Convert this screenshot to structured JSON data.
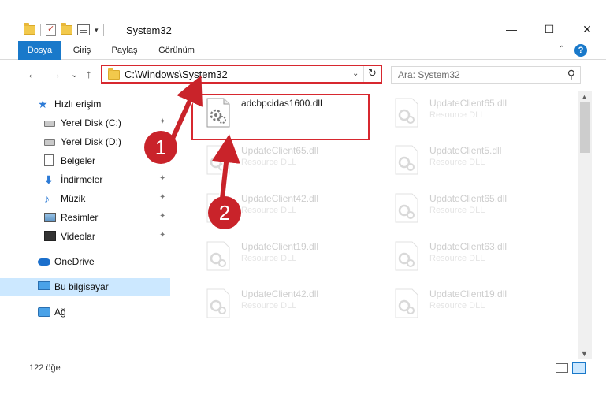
{
  "window": {
    "title": "System32",
    "min_glyph": "—",
    "max_glyph": "☐",
    "close_glyph": "✕"
  },
  "ribbon": {
    "tabs": [
      {
        "label": "Dosya",
        "active": true
      },
      {
        "label": "Giriş",
        "active": false
      },
      {
        "label": "Paylaş",
        "active": false
      },
      {
        "label": "Görünüm",
        "active": false
      }
    ],
    "help": "?",
    "collapse": "⌃"
  },
  "nav": {
    "back": "←",
    "forward": "→",
    "recent": "⌄",
    "up": "↑",
    "address": "C:\\Windows\\System32",
    "address_dropdown": "⌄",
    "refresh": "↻",
    "search_placeholder": "Ara: System32",
    "search_icon": "⚲"
  },
  "sidebar": {
    "items": [
      {
        "label": "Hızlı erişim",
        "icon": "star-icon",
        "pinned": false
      },
      {
        "label": "Yerel Disk (C:)",
        "icon": "drive-icon",
        "pinned": true
      },
      {
        "label": "Yerel Disk (D:)",
        "icon": "drive-icon",
        "pinned": true
      },
      {
        "label": "Belgeler",
        "icon": "document-icon",
        "pinned": true
      },
      {
        "label": "İndirmeler",
        "icon": "download-icon",
        "pinned": true
      },
      {
        "label": "Müzik",
        "icon": "music-icon",
        "pinned": true
      },
      {
        "label": "Resimler",
        "icon": "pictures-icon",
        "pinned": true
      },
      {
        "label": "Videolar",
        "icon": "videos-icon",
        "pinned": true
      },
      {
        "label": "OneDrive",
        "icon": "cloud-icon",
        "pinned": false
      },
      {
        "label": "Bu bilgisayar",
        "icon": "computer-icon",
        "pinned": false,
        "selected": true
      },
      {
        "label": "Ağ",
        "icon": "network-icon",
        "pinned": false
      }
    ],
    "pin_glyph": "📌"
  },
  "files": [
    {
      "name": "adcbpcidas1600.dll",
      "type": "",
      "faded": false
    },
    {
      "name": "UpdateClient65.dll",
      "type": "Resource DLL",
      "faded": true
    },
    {
      "name": "UpdateClient65.dll",
      "type": "Resource DLL",
      "faded": true
    },
    {
      "name": "UpdateClient5.dll",
      "type": "Resource DLL",
      "faded": true
    },
    {
      "name": "UpdateClient42.dll",
      "type": "Resource DLL",
      "faded": true
    },
    {
      "name": "UpdateClient65.dll",
      "type": "Resource DLL",
      "faded": true
    },
    {
      "name": "UpdateClient19.dll",
      "type": "Resource DLL",
      "faded": true
    },
    {
      "name": "UpdateClient63.dll",
      "type": "Resource DLL",
      "faded": true
    },
    {
      "name": "UpdateClient42.dll",
      "type": "Resource DLL",
      "faded": true
    },
    {
      "name": "UpdateClient19.dll",
      "type": "Resource DLL",
      "faded": true
    }
  ],
  "status": {
    "item_count": "122 öğe"
  },
  "annotations": {
    "step1": "1",
    "step2": "2",
    "color": "#c9232a"
  },
  "colors": {
    "accent": "#1979ca",
    "highlight": "#d7282f",
    "selected_bg": "#cce8ff"
  }
}
